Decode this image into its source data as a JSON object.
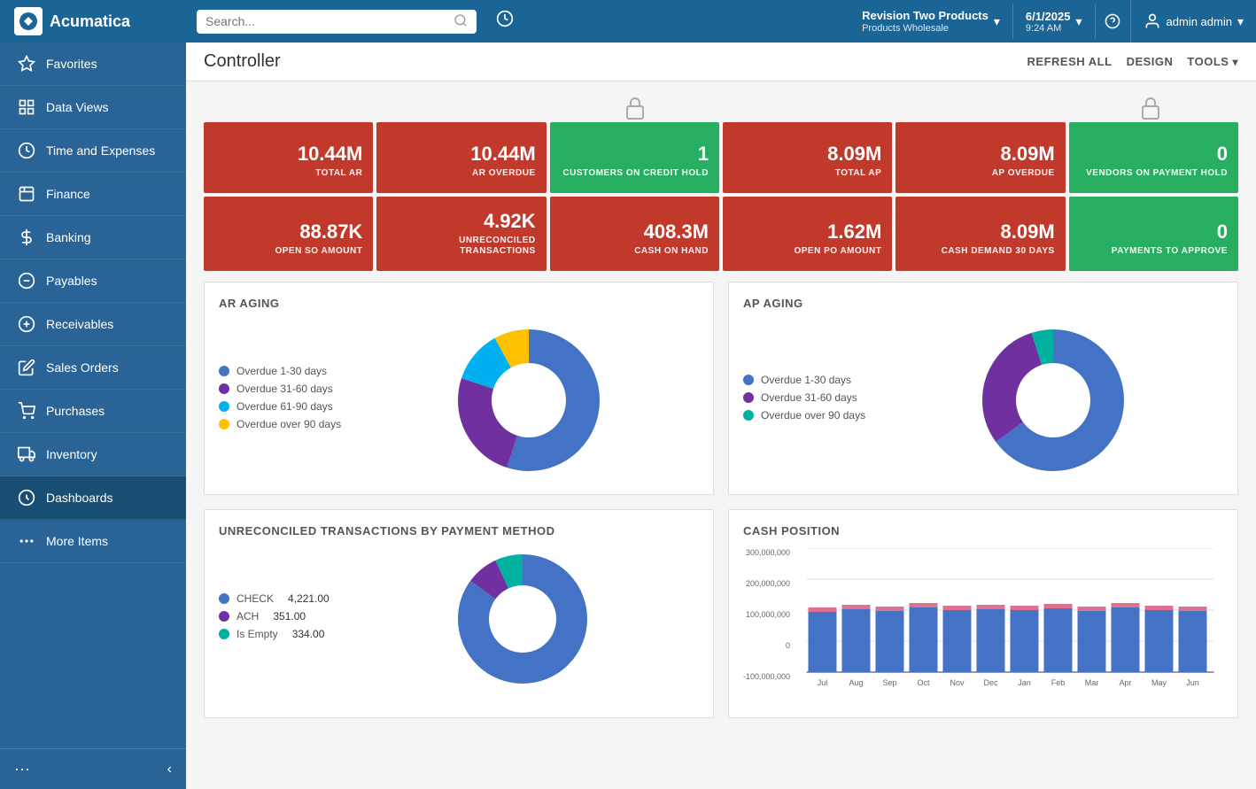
{
  "app": {
    "logo_text": "Acumatica"
  },
  "topnav": {
    "search_placeholder": "Search...",
    "company_name": "Revision Two Products",
    "company_sub": "Products Wholesale",
    "date": "6/1/2025",
    "time": "9:24 AM",
    "user": "admin admin",
    "chevron": "▾"
  },
  "header": {
    "title": "Controller",
    "refresh_all": "REFRESH ALL",
    "design": "DESIGN",
    "tools": "TOOLS"
  },
  "sidebar": {
    "items": [
      {
        "id": "favorites",
        "label": "Favorites",
        "icon": "star"
      },
      {
        "id": "data-views",
        "label": "Data Views",
        "icon": "chart"
      },
      {
        "id": "time-expenses",
        "label": "Time and Expenses",
        "icon": "clock"
      },
      {
        "id": "finance",
        "label": "Finance",
        "icon": "grid"
      },
      {
        "id": "banking",
        "label": "Banking",
        "icon": "dollar"
      },
      {
        "id": "payables",
        "label": "Payables",
        "icon": "minus-circle"
      },
      {
        "id": "receivables",
        "label": "Receivables",
        "icon": "plus-circle"
      },
      {
        "id": "sales-orders",
        "label": "Sales Orders",
        "icon": "edit"
      },
      {
        "id": "purchases",
        "label": "Purchases",
        "icon": "cart"
      },
      {
        "id": "inventory",
        "label": "Inventory",
        "icon": "truck"
      },
      {
        "id": "dashboards",
        "label": "Dashboards",
        "icon": "dashboard",
        "active": true
      },
      {
        "id": "more-items",
        "label": "More Items",
        "icon": "dots"
      }
    ]
  },
  "metrics_row1": [
    {
      "id": "total-ar",
      "value": "10.44M",
      "label": "TOTAL AR",
      "color": "red"
    },
    {
      "id": "ar-overdue",
      "value": "10.44M",
      "label": "AR OVERDUE",
      "color": "red"
    },
    {
      "id": "customers-credit-hold",
      "value": "1",
      "label": "CUSTOMERS ON CREDIT HOLD",
      "color": "green"
    },
    {
      "id": "total-ap",
      "value": "8.09M",
      "label": "TOTAL AP",
      "color": "red"
    },
    {
      "id": "ap-overdue",
      "value": "8.09M",
      "label": "AP OVERDUE",
      "color": "red"
    },
    {
      "id": "vendors-payment-hold",
      "value": "0",
      "label": "VENDORS ON PAYMENT HOLD",
      "color": "green"
    }
  ],
  "metrics_row2": [
    {
      "id": "open-so-amount",
      "value": "88.87K",
      "label": "OPEN SO AMOUNT",
      "color": "red"
    },
    {
      "id": "unreconciled-tx",
      "value": "4.92K",
      "label": "UNRECONCILED TRANSACTIONS",
      "color": "red"
    },
    {
      "id": "cash-on-hand",
      "value": "408.3M",
      "label": "CASH ON HAND",
      "color": "red"
    },
    {
      "id": "open-po-amount",
      "value": "1.62M",
      "label": "OPEN PO AMOUNT",
      "color": "red"
    },
    {
      "id": "cash-demand-30",
      "value": "8.09M",
      "label": "CASH DEMAND 30 DAYS",
      "color": "red"
    },
    {
      "id": "payments-to-approve",
      "value": "0",
      "label": "PAYMENTS TO APPROVE",
      "color": "green"
    }
  ],
  "ar_aging": {
    "title": "AR AGING",
    "legend": [
      {
        "label": "Overdue 1-30 days",
        "color": "#4472c4"
      },
      {
        "label": "Overdue 31-60 days",
        "color": "#7030a0"
      },
      {
        "label": "Overdue 61-90 days",
        "color": "#00b0f0"
      },
      {
        "label": "Overdue over 90 days",
        "color": "#ffc000"
      }
    ],
    "segments": [
      {
        "value": 55,
        "color": "#4472c4"
      },
      {
        "value": 25,
        "color": "#7030a0"
      },
      {
        "value": 12,
        "color": "#00b0f0"
      },
      {
        "value": 8,
        "color": "#ffc000"
      }
    ]
  },
  "ap_aging": {
    "title": "AP AGING",
    "legend": [
      {
        "label": "Overdue 1-30 days",
        "color": "#4472c4"
      },
      {
        "label": "Overdue 31-60 days",
        "color": "#7030a0"
      },
      {
        "label": "Overdue over 90 days",
        "color": "#00b0a0"
      }
    ],
    "segments": [
      {
        "value": 65,
        "color": "#4472c4"
      },
      {
        "value": 30,
        "color": "#7030a0"
      },
      {
        "value": 5,
        "color": "#00b0a0"
      }
    ]
  },
  "unreconciled": {
    "title": "UNRECONCILED TRANSACTIONS BY PAYMENT METHOD",
    "legend": [
      {
        "label": "CHECK",
        "value": "4,221.00",
        "color": "#4472c4"
      },
      {
        "label": "ACH",
        "value": "351.00",
        "color": "#7030a0"
      },
      {
        "label": "Is Empty",
        "value": "334.00",
        "color": "#00b0a0"
      }
    ],
    "segments": [
      {
        "value": 85,
        "color": "#4472c4"
      },
      {
        "value": 8,
        "color": "#7030a0"
      },
      {
        "value": 7,
        "color": "#00b0a0"
      }
    ]
  },
  "cash_position": {
    "title": "CASH POSITION",
    "y_labels": [
      "300,000,000",
      "200,000,000",
      "100,000,000",
      "0",
      "-100,000,000"
    ],
    "x_labels": [
      "Jul",
      "Aug",
      "Sep",
      "Oct",
      "Nov",
      "Dec",
      "Jan",
      "Feb",
      "Mar",
      "Apr",
      "May",
      "Jun"
    ],
    "bars": [
      {
        "blue": 180,
        "pink": 12
      },
      {
        "blue": 185,
        "pink": 11
      },
      {
        "blue": 182,
        "pink": 13
      },
      {
        "blue": 188,
        "pink": 10
      },
      {
        "blue": 183,
        "pink": 12
      },
      {
        "blue": 185,
        "pink": 11
      },
      {
        "blue": 184,
        "pink": 10
      },
      {
        "blue": 186,
        "pink": 12
      },
      {
        "blue": 183,
        "pink": 11
      },
      {
        "blue": 187,
        "pink": 10
      },
      {
        "blue": 184,
        "pink": 12
      },
      {
        "blue": 182,
        "pink": 11
      }
    ]
  }
}
